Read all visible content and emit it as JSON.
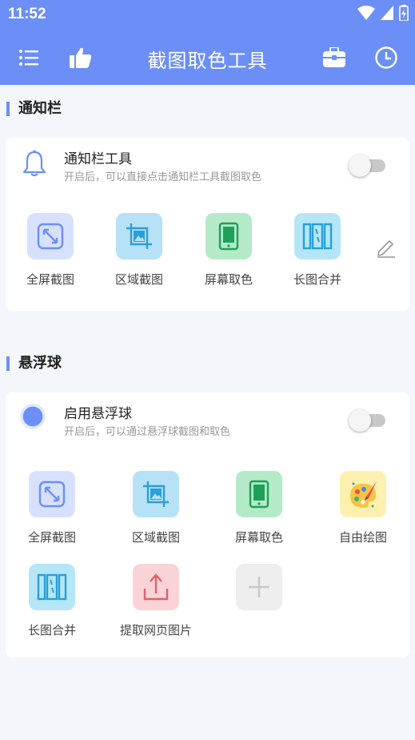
{
  "status": {
    "time": "11:52"
  },
  "appbar": {
    "title": "截图取色工具"
  },
  "notification": {
    "section_title": "通知栏",
    "title": "通知栏工具",
    "subtitle": "开启后，可以直接点击通知栏工具截图取色",
    "enabled": false,
    "tools": [
      "全屏截图",
      "区域截图",
      "屏幕取色",
      "长图合并"
    ]
  },
  "floating": {
    "section_title": "悬浮球",
    "title": "启用悬浮球",
    "subtitle": "开启后，可以通过悬浮球截图和取色",
    "enabled": false,
    "tools": [
      "全屏截图",
      "区域截图",
      "屏幕取色",
      "自由绘图",
      "长图合并",
      "提取网页图片"
    ]
  },
  "colors": {
    "primary": "#6b8ff7",
    "background": "#f3f6fb"
  }
}
